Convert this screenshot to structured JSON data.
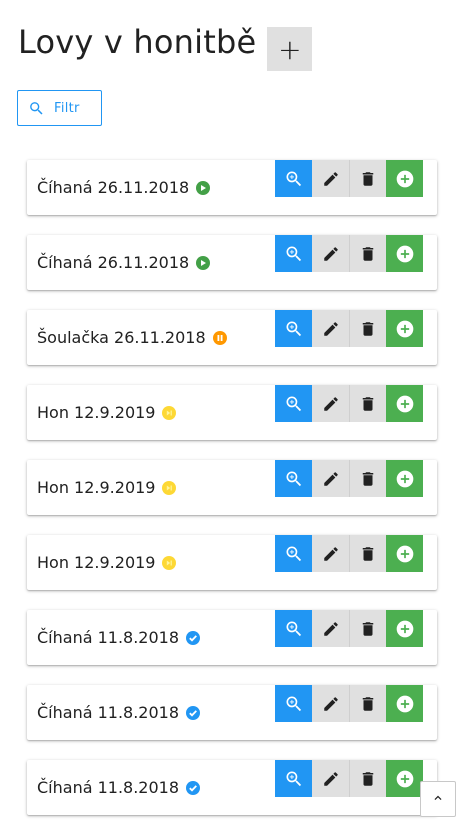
{
  "header": {
    "title": "Lovy v honitbě",
    "add_label": "+"
  },
  "filter": {
    "label": "Filtr",
    "icon": "search-icon"
  },
  "colors": {
    "blue": "#2196f3",
    "green": "#4caf50",
    "gray": "#e0e0e0",
    "running": "#43a047",
    "paused": "#ff9800",
    "planned": "#fdd835",
    "done": "#2196f3"
  },
  "hunts": [
    {
      "title": "Číhaná 26.11.2018",
      "status": "running"
    },
    {
      "title": "Číhaná 26.11.2018",
      "status": "running"
    },
    {
      "title": "Šoulačka 26.11.2018",
      "status": "paused"
    },
    {
      "title": "Hon 12.9.2019",
      "status": "planned"
    },
    {
      "title": "Hon 12.9.2019",
      "status": "planned"
    },
    {
      "title": "Hon 12.9.2019",
      "status": "planned"
    },
    {
      "title": "Číhaná 11.8.2018",
      "status": "done"
    },
    {
      "title": "Číhaná 11.8.2018",
      "status": "done"
    },
    {
      "title": "Číhaná 11.8.2018",
      "status": "done"
    }
  ],
  "actions": [
    "zoom-in-icon",
    "pencil-icon",
    "trash-icon",
    "plus-circle-icon"
  ],
  "scroll_top": {
    "icon": "chevron-up-icon"
  }
}
